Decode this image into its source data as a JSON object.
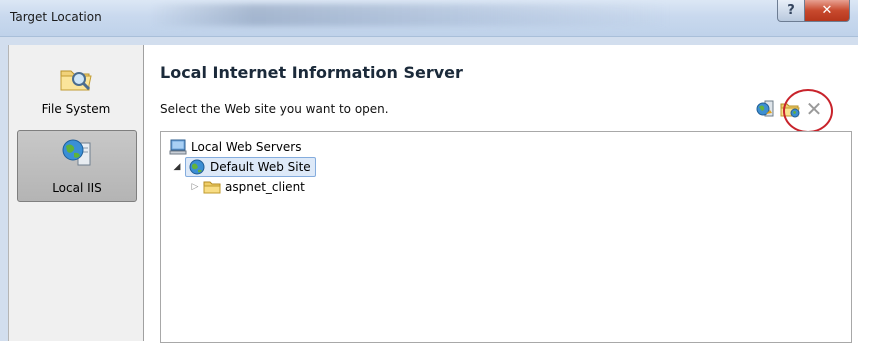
{
  "window": {
    "title": "Target Location"
  },
  "caption_buttons": {
    "help": "?",
    "close": "✕"
  },
  "sidebar": {
    "items": [
      {
        "label": "File System",
        "icon": "folder-search-icon",
        "selected": false
      },
      {
        "label": "Local IIS",
        "icon": "iis-globe-server-icon",
        "selected": true
      }
    ]
  },
  "main": {
    "heading": "Local Internet Information Server",
    "instruction": "Select the Web site you want to open.",
    "toolbar": {
      "refresh_icon": "refresh-server-icon",
      "new_folder_icon": "new-virtual-directory-icon",
      "delete_icon": "delete-icon",
      "delete_glyph": "✕",
      "highlight_color": "#c8232b"
    },
    "tree": {
      "root": {
        "label": "Local Web Servers",
        "icon": "computer-icon"
      },
      "site": {
        "label": "Default Web Site",
        "icon": "globe-icon",
        "expander": "◢",
        "selected": true
      },
      "child": {
        "label": "aspnet_client",
        "icon": "folder-icon",
        "expander": "▷"
      }
    }
  },
  "colors": {
    "selection_bg": "#dde9f8",
    "selection_border": "#84acdd",
    "close_button": "#c84a2e"
  }
}
